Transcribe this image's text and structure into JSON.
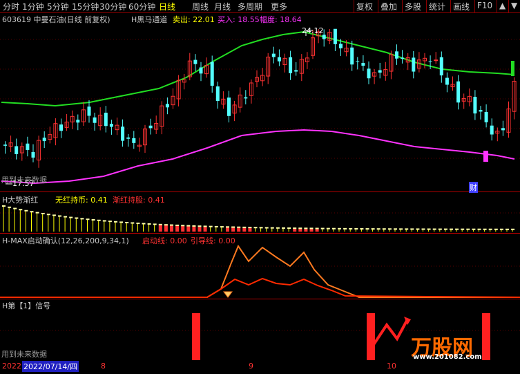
{
  "toolbar": {
    "periods": [
      "分时",
      "1分钟",
      "5分钟",
      "15分钟",
      "30分钟",
      "60分钟",
      "日线",
      "周线",
      "月线",
      "多周期",
      "更多"
    ],
    "active_period": "日线",
    "right_buttons": [
      "复权",
      "叠加",
      "多股",
      "统计",
      "画线",
      "F10",
      "▲",
      "▼"
    ]
  },
  "main_header": {
    "stock": "603619 中曼石油(日线 前复权)",
    "indicator": "H黑马通道",
    "sell_label": "卖出: 22.01",
    "buy_label": "买入: 18.55",
    "range_label": "幅度: 18.64"
  },
  "main_chart": {
    "high_label": "24.12",
    "low_label": "17.57",
    "overlay_left": "用到未来数据",
    "finance_badge": "财"
  },
  "panel1": {
    "name": "H大势渐红",
    "l1": "无红持币: 0.41",
    "l2": "渐红持股: 0.41"
  },
  "panel2": {
    "name": "H-MAX启动确认(12,26,200,9,34,1)",
    "l1": "启动线: 0.00",
    "l2": "引导线: 0.00"
  },
  "panel3": {
    "name": "H第【1】信号",
    "overlay_left": "用到未来数据"
  },
  "watermark": {
    "brand": "万股网",
    "url": "www.201082.com"
  },
  "date_axis": {
    "year": "2022",
    "cursor_date": "2022/07/14/四",
    "month_labels": [
      "8",
      "9",
      "10"
    ]
  },
  "colors": {
    "up": "#ff3232",
    "down": "#54ffff",
    "upper_band": "#22dd22",
    "lower_band": "#ff33ff",
    "yellow": "#ffff00",
    "panel_sep": "#b00000"
  }
}
